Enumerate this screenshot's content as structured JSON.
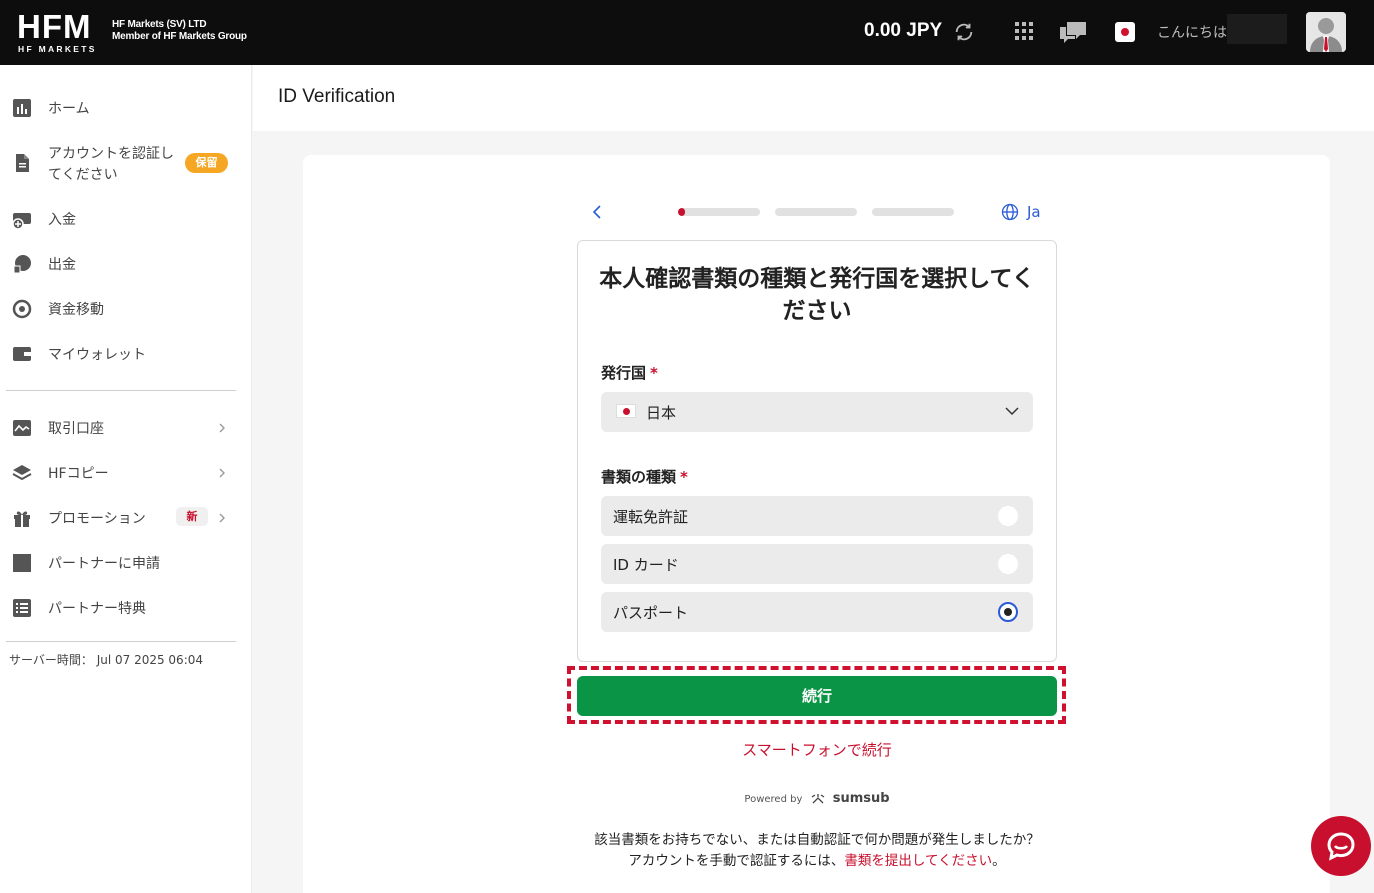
{
  "header": {
    "logo_main": "HFM",
    "logo_sub": "HF MARKETS",
    "company_line1": "HF Markets (SV) LTD",
    "company_line2": "Member of HF Markets Group",
    "balance": "0.00 JPY",
    "greeting": "こんにちは",
    "icons": [
      "refresh-icon",
      "apps-grid-icon",
      "chat-icon",
      "language-flag-icon",
      "user-avatar"
    ]
  },
  "sidebar": {
    "items": [
      {
        "label": "ホーム",
        "icon": "chart-icon"
      },
      {
        "label": "アカウントを認証し",
        "label2": "てください",
        "icon": "document-icon",
        "badge": "保留"
      },
      {
        "label": "入金",
        "icon": "deposit-icon"
      },
      {
        "label": "出金",
        "icon": "withdraw-icon"
      },
      {
        "label": "資金移動",
        "icon": "transfer-icon"
      },
      {
        "label": "マイウォレット",
        "icon": "wallet-icon"
      },
      {
        "label": "取引口座",
        "icon": "trading-icon"
      },
      {
        "label": "HFコピー",
        "icon": "layers-icon"
      },
      {
        "label": "プロモーション",
        "icon": "gift-icon",
        "badge": "新"
      },
      {
        "label": "パートナーに申請",
        "icon": "partner-icon"
      },
      {
        "label": "パートナー特典",
        "icon": "list-icon"
      }
    ],
    "server_time": "サーバー時間： Jul 07 2025 06:04"
  },
  "main": {
    "page_title": "ID Verification",
    "language": "Ja",
    "steps": {
      "total": 3,
      "current": 1,
      "current_fill": 0.08
    },
    "heading": "本人確認書類の種類と発行国を選択してください",
    "country_label": "発行国",
    "required_mark": "*",
    "country_value": "日本",
    "doc_type_label": "書類の種類",
    "doc_options": [
      {
        "label": "運転免許証",
        "checked": false
      },
      {
        "label": "ID カード",
        "checked": false
      },
      {
        "label": "パスポート",
        "checked": true
      }
    ],
    "continue_label": "続行",
    "phone_link": "スマートフォンで続行",
    "powered_by": "Powered by",
    "powered_brand": "sumsub",
    "help_line1": "該当書類をお持ちでない、または自動認証で何か問題が発生しましたか？",
    "help_line2_prefix": "アカウントを手動で認証するには、",
    "help_line2_link": "書類を提出してください",
    "help_line2_suffix": "。"
  },
  "colors": {
    "brand_red": "#c8102e",
    "continue_green": "#0a9445",
    "link_blue": "#2a5bd7",
    "badge_orange": "#f5a623"
  }
}
